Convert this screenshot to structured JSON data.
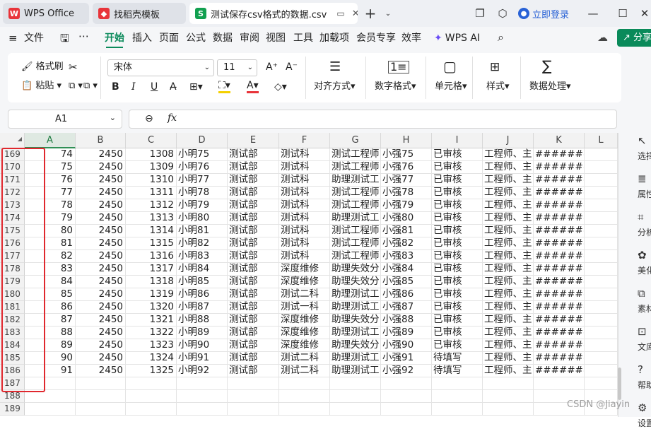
{
  "tabs": [
    {
      "label": "WPS Office",
      "icon": "wps-logo-icon"
    },
    {
      "label": "找稻壳模板",
      "icon": "docer-icon"
    },
    {
      "label": "测试保存csv格式的数据.csv",
      "icon": "spreadsheet-icon"
    }
  ],
  "topbar": {
    "new_tab": "+",
    "login_label": "立即登录"
  },
  "menu": {
    "file": "文件",
    "items": [
      "开始",
      "插入",
      "页面",
      "公式",
      "数据",
      "审阅",
      "视图",
      "工具",
      "加载项",
      "会员专享",
      "效率"
    ],
    "active": "开始",
    "wps_ai": "WPS AI",
    "share": "分享"
  },
  "ribbon": {
    "format_painter": "格式刷",
    "paste": "粘贴",
    "font_name": "宋体",
    "font_size": "11",
    "align": "对齐方式",
    "number_format": "数字格式",
    "cell": "单元格",
    "style": "样式",
    "data_process": "数据处理"
  },
  "formula_bar": {
    "name_box": "A1",
    "fx": "fx",
    "formula": ""
  },
  "columns": [
    "A",
    "B",
    "C",
    "D",
    "E",
    "F",
    "G",
    "H",
    "I",
    "J",
    "K",
    "L"
  ],
  "rows": [
    {
      "n": "169",
      "a": "74",
      "b": "2450",
      "c": "1308",
      "d": "小明75",
      "e": "测试部",
      "f": "测试科",
      "g": "测试工程师",
      "h": "小强75",
      "i": "已审核",
      "j": "工程师、主",
      "k": "#########"
    },
    {
      "n": "170",
      "a": "75",
      "b": "2450",
      "c": "1309",
      "d": "小明76",
      "e": "测试部",
      "f": "测试科",
      "g": "测试工程师",
      "h": "小强76",
      "i": "已审核",
      "j": "工程师、主",
      "k": "#########"
    },
    {
      "n": "171",
      "a": "76",
      "b": "2450",
      "c": "1310",
      "d": "小明77",
      "e": "测试部",
      "f": "测试科",
      "g": "助理测试工",
      "h": "小强77",
      "i": "已审核",
      "j": "工程师、主",
      "k": "#########"
    },
    {
      "n": "172",
      "a": "77",
      "b": "2450",
      "c": "1311",
      "d": "小明78",
      "e": "测试部",
      "f": "测试科",
      "g": "测试工程师",
      "h": "小强78",
      "i": "已审核",
      "j": "工程师、主",
      "k": "#########"
    },
    {
      "n": "173",
      "a": "78",
      "b": "2450",
      "c": "1312",
      "d": "小明79",
      "e": "测试部",
      "f": "测试科",
      "g": "测试工程师",
      "h": "小强79",
      "i": "已审核",
      "j": "工程师、主",
      "k": "#########"
    },
    {
      "n": "174",
      "a": "79",
      "b": "2450",
      "c": "1313",
      "d": "小明80",
      "e": "测试部",
      "f": "测试科",
      "g": "助理测试工",
      "h": "小强80",
      "i": "已审核",
      "j": "工程师、主",
      "k": "#########"
    },
    {
      "n": "175",
      "a": "80",
      "b": "2450",
      "c": "1314",
      "d": "小明81",
      "e": "测试部",
      "f": "测试科",
      "g": "测试工程师",
      "h": "小强81",
      "i": "已审核",
      "j": "工程师、主",
      "k": "#########"
    },
    {
      "n": "176",
      "a": "81",
      "b": "2450",
      "c": "1315",
      "d": "小明82",
      "e": "测试部",
      "f": "测试科",
      "g": "测试工程师",
      "h": "小强82",
      "i": "已审核",
      "j": "工程师、主",
      "k": "#########"
    },
    {
      "n": "177",
      "a": "82",
      "b": "2450",
      "c": "1316",
      "d": "小明83",
      "e": "测试部",
      "f": "测试科",
      "g": "测试工程师",
      "h": "小强83",
      "i": "已审核",
      "j": "工程师、主",
      "k": "#########"
    },
    {
      "n": "178",
      "a": "83",
      "b": "2450",
      "c": "1317",
      "d": "小明84",
      "e": "测试部",
      "f": "深度维修",
      "g": "助理失效分",
      "h": "小强84",
      "i": "已审核",
      "j": "工程师、主",
      "k": "#########"
    },
    {
      "n": "179",
      "a": "84",
      "b": "2450",
      "c": "1318",
      "d": "小明85",
      "e": "测试部",
      "f": "深度维修",
      "g": "助理失效分",
      "h": "小强85",
      "i": "已审核",
      "j": "工程师、主",
      "k": "#########"
    },
    {
      "n": "180",
      "a": "85",
      "b": "2450",
      "c": "1319",
      "d": "小明86",
      "e": "测试部",
      "f": "测试二科",
      "g": "助理测试工",
      "h": "小强86",
      "i": "已审核",
      "j": "工程师、主",
      "k": "#########"
    },
    {
      "n": "181",
      "a": "86",
      "b": "2450",
      "c": "1320",
      "d": "小明87",
      "e": "测试部",
      "f": "测试一科",
      "g": "助理测试工",
      "h": "小强87",
      "i": "已审核",
      "j": "工程师、主",
      "k": "#########"
    },
    {
      "n": "182",
      "a": "87",
      "b": "2450",
      "c": "1321",
      "d": "小明88",
      "e": "测试部",
      "f": "深度维修",
      "g": "助理失效分",
      "h": "小强88",
      "i": "已审核",
      "j": "工程师、主",
      "k": "#########"
    },
    {
      "n": "183",
      "a": "88",
      "b": "2450",
      "c": "1322",
      "d": "小明89",
      "e": "测试部",
      "f": "深度维修",
      "g": "助理测试工",
      "h": "小强89",
      "i": "已审核",
      "j": "工程师、主",
      "k": "#########"
    },
    {
      "n": "184",
      "a": "89",
      "b": "2450",
      "c": "1323",
      "d": "小明90",
      "e": "测试部",
      "f": "深度维修",
      "g": "助理失效分",
      "h": "小强90",
      "i": "已审核",
      "j": "工程师、主",
      "k": "#########"
    },
    {
      "n": "185",
      "a": "90",
      "b": "2450",
      "c": "1324",
      "d": "小明91",
      "e": "测试部",
      "f": "测试二科",
      "g": "助理测试工",
      "h": "小强91",
      "i": "待填写",
      "j": "工程师、主",
      "k": "#########"
    },
    {
      "n": "186",
      "a": "91",
      "b": "2450",
      "c": "1325",
      "d": "小明92",
      "e": "测试部",
      "f": "测试二科",
      "g": "助理测试工",
      "h": "小强92",
      "i": "待填写",
      "j": "工程师、主",
      "k": "#########"
    },
    {
      "n": "187"
    },
    {
      "n": "188"
    },
    {
      "n": "189"
    }
  ],
  "right_panel": [
    "选择",
    "属性",
    "分析",
    "美化",
    "素材",
    "文库",
    "帮助",
    "设置"
  ],
  "watermark": "CSDN @Jiayin",
  "colors": {
    "accent": "#0a8a5a",
    "highlight_box": "#e0282e",
    "wps_red": "#e8343a"
  }
}
